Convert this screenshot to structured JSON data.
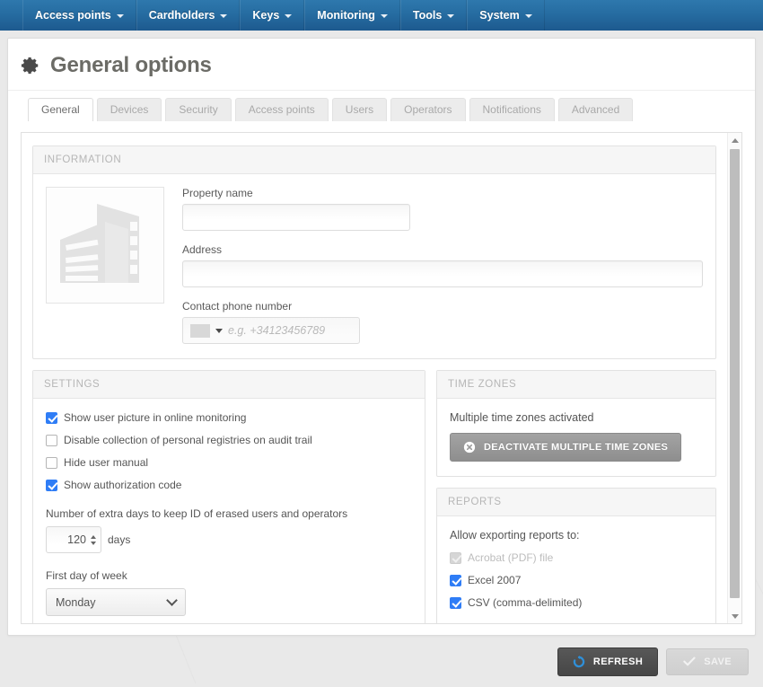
{
  "navbar": {
    "items": [
      {
        "label": "Access points",
        "icon": "chevron-down-icon"
      },
      {
        "label": "Cardholders",
        "icon": "chevron-down-icon"
      },
      {
        "label": "Keys",
        "icon": "chevron-down-icon"
      },
      {
        "label": "Monitoring",
        "icon": "chevron-down-icon"
      },
      {
        "label": "Tools",
        "icon": "chevron-down-icon"
      },
      {
        "label": "System",
        "icon": "chevron-down-icon"
      }
    ]
  },
  "header": {
    "title": "General options",
    "icon": "gear-icon"
  },
  "tabs": [
    {
      "label": "General",
      "active": true
    },
    {
      "label": "Devices",
      "active": false
    },
    {
      "label": "Security",
      "active": false
    },
    {
      "label": "Access points",
      "active": false
    },
    {
      "label": "Users",
      "active": false
    },
    {
      "label": "Operators",
      "active": false
    },
    {
      "label": "Notifications",
      "active": false
    },
    {
      "label": "Advanced",
      "active": false
    }
  ],
  "information": {
    "panel_title": "INFORMATION",
    "image_icon": "building-placeholder-icon",
    "property_name": {
      "label": "Property name",
      "value": "",
      "placeholder": ""
    },
    "address": {
      "label": "Address",
      "value": "",
      "placeholder": ""
    },
    "contact_phone": {
      "label": "Contact phone number",
      "value": "",
      "placeholder": "e.g. +34123456789",
      "country_icon": "flag-icon"
    }
  },
  "settings": {
    "panel_title": "SETTINGS",
    "checkboxes": [
      {
        "label": "Show user picture in online monitoring",
        "checked": true,
        "disabled": false
      },
      {
        "label": "Disable collection of personal registries on audit trail",
        "checked": false,
        "disabled": false
      },
      {
        "label": "Hide user manual",
        "checked": false,
        "disabled": false
      },
      {
        "label": "Show authorization code",
        "checked": true,
        "disabled": false
      }
    ],
    "extra_days": {
      "label": "Number of extra days to keep ID of erased users and operators",
      "value": "120",
      "units": "days"
    },
    "first_day_of_week": {
      "label": "First day of week",
      "value": "Monday"
    }
  },
  "time_zones": {
    "panel_title": "TIME ZONES",
    "status_text": "Multiple time zones activated",
    "button_label": "DEACTIVATE MULTIPLE TIME ZONES",
    "button_icon": "close-circle-icon"
  },
  "reports": {
    "panel_title": "REPORTS",
    "intro": "Allow exporting reports to:",
    "checkboxes": [
      {
        "label": "Acrobat (PDF) file",
        "checked": true,
        "disabled": true
      },
      {
        "label": "Excel 2007",
        "checked": true,
        "disabled": false
      },
      {
        "label": "CSV (comma-delimited)",
        "checked": true,
        "disabled": false
      }
    ]
  },
  "footer": {
    "refresh_label": "REFRESH",
    "refresh_icon": "refresh-icon",
    "save_label": "SAVE",
    "save_icon": "check-icon",
    "save_disabled": true
  },
  "scrollbar": {
    "up_icon": "scroll-up-icon",
    "down_icon": "scroll-down-icon"
  },
  "colors": {
    "navbar_blue": "#256ba0",
    "checkbox_blue": "#2f7df6",
    "title_grey": "#6b6b66",
    "button_dark": "#4a4a4a",
    "refresh_icon_blue": "#2f8fd8"
  }
}
